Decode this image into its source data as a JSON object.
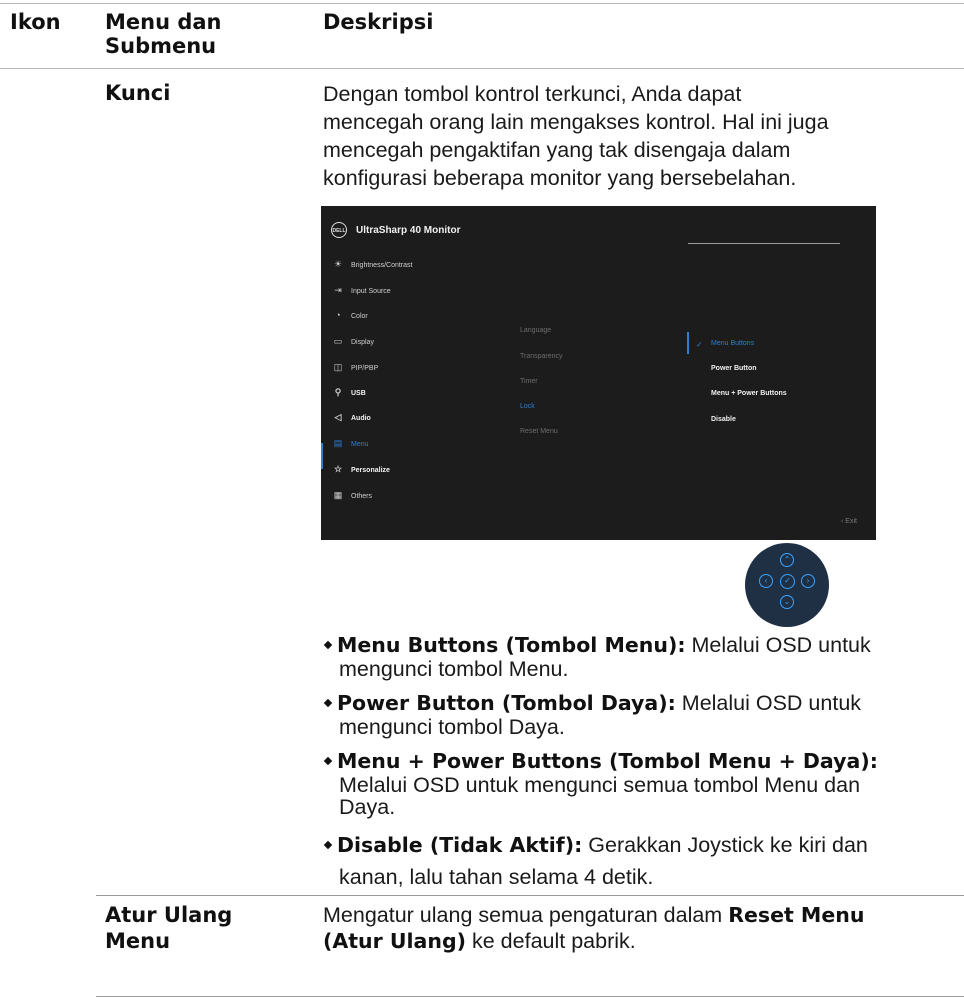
{
  "header": {
    "col_icon": "Ikon",
    "col_menu_line1": "Menu dan",
    "col_menu_line2": "Submenu",
    "col_desc": "Deskripsi"
  },
  "lock_row": {
    "term": "Kunci",
    "desc_lines": [
      "Dengan tombol kontrol terkunci, Anda dapat",
      "mencegah orang lain mengakses kontrol. Hal ini juga",
      "mencegah pengaktifan yang tak disengaja dalam",
      "konfigurasi beberapa monitor yang bersebelahan."
    ]
  },
  "osd": {
    "logo": "DELL",
    "title": "UltraSharp 40 Monitor",
    "menu": [
      {
        "label": "Brightness/Contrast",
        "icon": "☀"
      },
      {
        "label": "Input Source",
        "icon": "⇥"
      },
      {
        "label": "Color",
        "icon": "◔"
      },
      {
        "label": "Display",
        "icon": "▭"
      },
      {
        "label": "PIP/PBP",
        "icon": "◫"
      },
      {
        "label": "USB",
        "icon": "⚲"
      },
      {
        "label": "Audio",
        "icon": "◁"
      },
      {
        "label": "Menu",
        "icon": "▤"
      },
      {
        "label": "Personalize",
        "icon": "☆"
      },
      {
        "label": "Others",
        "icon": "▦"
      }
    ],
    "submenu": [
      "Language",
      "Transparency",
      "Timer",
      "Lock",
      "Reset Menu"
    ],
    "options": [
      "Menu Buttons",
      "Power Button",
      "Menu + Power Buttons",
      "Disable"
    ],
    "check": "✓",
    "exit": "‹  Exit",
    "accent": "#2d7fd6"
  },
  "joystick": {
    "up": "⌃",
    "left": "‹",
    "center": "✓",
    "right": "›",
    "down": "⌄"
  },
  "bullets": [
    {
      "bold": "Menu Buttons (Tombol Menu):",
      "text": " Melalui OSD untuk",
      "cont": [
        "mengunci tombol Menu."
      ]
    },
    {
      "bold": "Power Button (Tombol Daya):",
      "text": " Melalui OSD untuk",
      "cont": [
        "mengunci tombol Daya."
      ]
    },
    {
      "bold": "Menu + Power Buttons (Tombol Menu + Daya):",
      "text": "",
      "cont": [
        "Melalui OSD untuk mengunci semua tombol Menu dan",
        "Daya."
      ]
    },
    {
      "bold": "Disable (Tidak Aktif):",
      "text": " Gerakkan Joystick ke kiri dan",
      "cont": [
        "kanan, lalu tahan selama 4 detik."
      ]
    }
  ],
  "reset_row": {
    "term_line1": "Atur Ulang",
    "term_line2": "Menu",
    "desc_pre": "Mengatur ulang semua pengaturan dalam ",
    "desc_bold1": "Reset Menu",
    "desc_bold2": "(Atur Ulang)",
    "desc_post": " ke default pabrik."
  }
}
